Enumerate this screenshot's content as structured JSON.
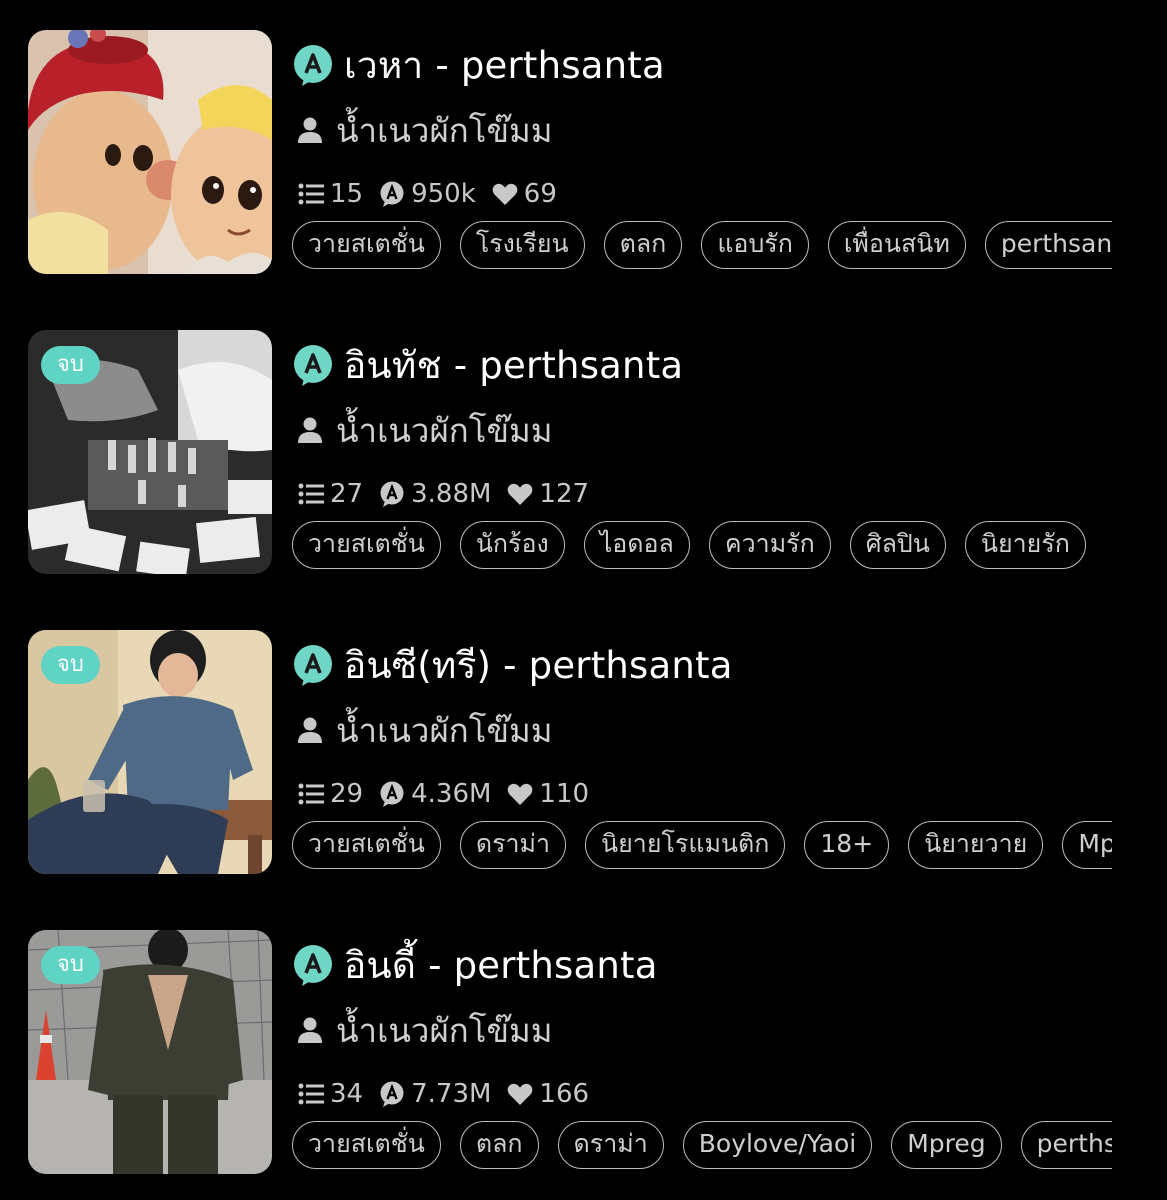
{
  "stories": [
    {
      "title": "เวหา - perthsanta",
      "author": "น้ำเนวผักโข๊มม",
      "chapters": "15",
      "views": "950k",
      "likes": "69",
      "tags": [
        "วายสเตชั่น",
        "โรงเรียน",
        "ตลก",
        "แอบรัก",
        "เพื่อนสนิท",
        "perthsanta"
      ]
    },
    {
      "badge": "จบ",
      "title": "อินทัช - perthsanta",
      "author": "น้ำเนวผักโข๊มม",
      "chapters": "27",
      "views": "3.88M",
      "likes": "127",
      "tags": [
        "วายสเตชั่น",
        "นักร้อง",
        "ไอดอล",
        "ความรัก",
        "ศิลปิน",
        "นิยายรัก"
      ]
    },
    {
      "badge": "จบ",
      "title": "อินซี(ทรี) - perthsanta",
      "author": "น้ำเนวผักโข๊มม",
      "chapters": "29",
      "views": "4.36M",
      "likes": "110",
      "tags": [
        "วายสเตชั่น",
        "ดราม่า",
        "นิยายโรแมนติก",
        "18+",
        "นิยายวาย",
        "Mpreg"
      ]
    },
    {
      "badge": "จบ",
      "title": "อินดี้ - perthsanta",
      "author": "น้ำเนวผักโข๊มม",
      "chapters": "34",
      "views": "7.73M",
      "likes": "166",
      "tags": [
        "วายสเตชั่น",
        "ตลก",
        "ดราม่า",
        "Boylove/Yaoi",
        "Mpreg",
        "perthsanta"
      ]
    }
  ],
  "colors": {
    "background": "#000000",
    "badge": "#5fd3c4",
    "app_icon": "#6fd6c6",
    "tag_border": "#bdbdbd",
    "text_primary": "#ffffff",
    "text_secondary": "#c8c8c8"
  },
  "icons": {
    "app": "app-logo-icon",
    "author": "user-icon",
    "chapters": "list-icon",
    "views": "views-icon",
    "likes": "heart-icon"
  }
}
